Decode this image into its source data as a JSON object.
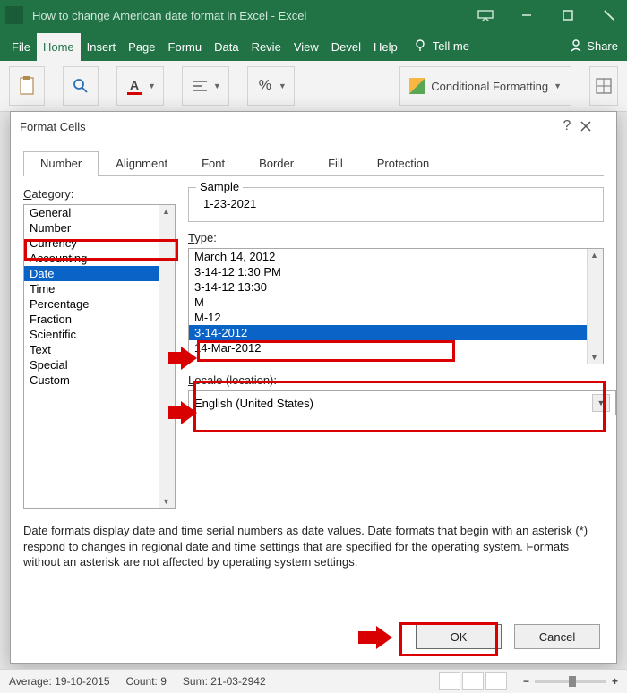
{
  "window": {
    "title": "How to change American date format in Excel  -  Excel"
  },
  "ribbon": {
    "tabs": [
      "File",
      "Home",
      "Insert",
      "Page",
      "Formu",
      "Data",
      "Revie",
      "View",
      "Devel",
      "Help"
    ],
    "tell_me": "Tell me",
    "share": "Share",
    "conditional_formatting": "Conditional Formatting"
  },
  "dialog": {
    "title": "Format Cells",
    "tabs": [
      "Number",
      "Alignment",
      "Font",
      "Border",
      "Fill",
      "Protection"
    ],
    "category_label": "Category:",
    "categories": [
      "General",
      "Number",
      "Currency",
      "Accounting",
      "Date",
      "Time",
      "Percentage",
      "Fraction",
      "Scientific",
      "Text",
      "Special",
      "Custom"
    ],
    "selected_category": "Date",
    "sample_label": "Sample",
    "sample_value": "1-23-2021",
    "type_label": "Type:",
    "types": [
      "March 14, 2012",
      "3-14-12 1:30 PM",
      "3-14-12 13:30",
      "M",
      "M-12",
      "3-14-2012",
      "14-Mar-2012"
    ],
    "selected_type": "3-14-2012",
    "locale_label": "Locale (location):",
    "locale_value": "English (United States)",
    "description": "Date formats display date and time serial numbers as date values.  Date formats that begin with an asterisk (*) respond to changes in regional date and time settings that are specified for the operating system. Formats without an asterisk are not affected by operating system settings.",
    "ok": "OK",
    "cancel": "Cancel"
  },
  "statusbar": {
    "average": "Average: 19-10-2015",
    "count": "Count: 9",
    "sum": "Sum: 21-03-2942"
  }
}
